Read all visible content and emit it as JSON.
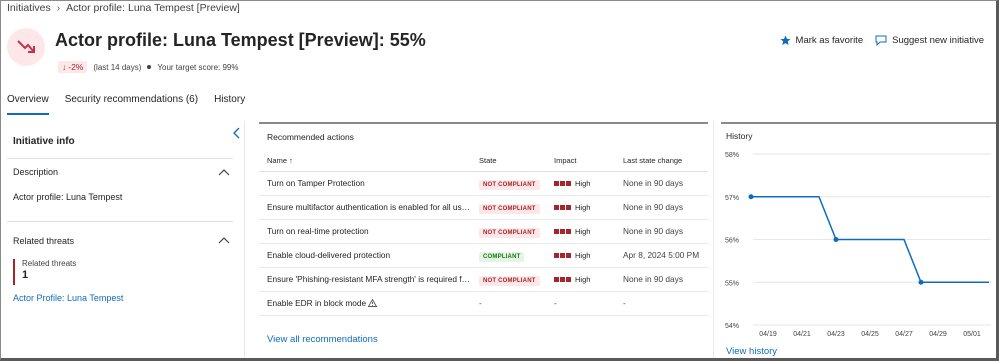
{
  "breadcrumb": {
    "root": "Initiatives",
    "current": "Actor profile: Luna Tempest [Preview]"
  },
  "page": {
    "title": "Actor profile: Luna Tempest [Preview]: 55%",
    "trend": "-2%",
    "trend_period": "(last 14 days)",
    "target": "Your target score: 99%"
  },
  "actions": {
    "favorite": "Mark as favorite",
    "suggest": "Suggest new initiative"
  },
  "tabs": [
    {
      "label": "Overview",
      "active": true
    },
    {
      "label": "Security recommendations (6)",
      "active": false
    },
    {
      "label": "History",
      "active": false
    }
  ],
  "info": {
    "title": "Initiative info",
    "description_label": "Description",
    "description_text": "Actor profile: Luna Tempest",
    "related_label": "Related threats",
    "related_box_label": "Related threats",
    "related_count": "1",
    "related_link": "Actor Profile: Luna Tempest"
  },
  "recommended": {
    "title": "Recommended actions",
    "columns": [
      "Name ↑",
      "State",
      "Impact",
      "Last state change"
    ],
    "rows": [
      {
        "name": "Turn on Tamper Protection",
        "state": "NOT COMPLIANT",
        "impact": "High",
        "last": "None in 90 days"
      },
      {
        "name": "Ensure multifactor authentication is enabled for all use...",
        "state": "NOT COMPLIANT",
        "impact": "High",
        "last": "None in 90 days"
      },
      {
        "name": "Turn on real-time protection",
        "state": "NOT COMPLIANT",
        "impact": "High",
        "last": "None in 90 days"
      },
      {
        "name": "Enable cloud-delivered protection",
        "state": "COMPLIANT",
        "impact": "High",
        "last": "Apr 8, 2024 5:00 PM"
      },
      {
        "name": "Ensure 'Phishing-resistant MFA strength' is required for...",
        "state": "NOT COMPLIANT",
        "impact": "High",
        "last": "None in 90 days"
      },
      {
        "name": "Enable EDR in block mode",
        "state": "-",
        "impact": "-",
        "last": "-"
      }
    ],
    "view_all": "View all recommendations"
  },
  "history": {
    "title": "History",
    "view_link": "View history"
  },
  "chart_data": {
    "type": "line",
    "y_ticks": [
      "58%",
      "57%",
      "56%",
      "55%",
      "54%"
    ],
    "ylim": [
      54,
      58
    ],
    "x_ticks": [
      "04/19",
      "04/21",
      "04/23",
      "04/25",
      "04/27",
      "04/29",
      "05/01"
    ],
    "series": [
      {
        "values": [
          {
            "x": "04/18",
            "y": 57
          },
          {
            "x": "04/22",
            "y": 57
          },
          {
            "x": "04/23",
            "y": 56
          },
          {
            "x": "04/27",
            "y": 56
          },
          {
            "x": "04/28",
            "y": 55
          },
          {
            "x": "05/02",
            "y": 55
          }
        ]
      }
    ],
    "markers": [
      {
        "x": "04/18",
        "y": 57
      },
      {
        "x": "04/23",
        "y": 56
      },
      {
        "x": "04/28",
        "y": 55
      }
    ],
    "color": "#0f6cbd"
  }
}
